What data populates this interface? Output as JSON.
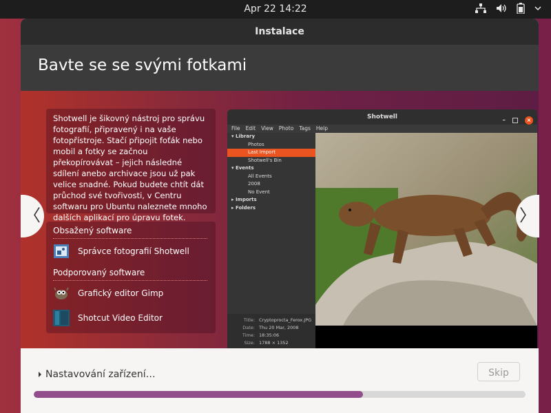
{
  "topbar": {
    "clock": "Apr 22  14:22",
    "icons": [
      "network-icon",
      "volume-icon",
      "battery-icon",
      "power-menu-icon"
    ]
  },
  "window": {
    "title": "Instalace"
  },
  "slide": {
    "title": "Bavte se se svými fotkami",
    "description": "Shotwell je šikovný nástroj pro správu fotografií, připravený i na vaše fotopřístroje. Stačí připojit foťák nebo mobil a fotky se začnou překopírovávat – jejich následné sdílení anebo archivace jsou už pak velice snadné. Pokud budete chtít dát průchod své tvořivosti, v Centru softwaru pro Ubuntu naleznete mnoho dalších aplikací pro úpravu fotek.",
    "included_heading": "Obsažený software",
    "included": [
      {
        "label": "Správce fotografií Shotwell",
        "icon": "shotwell-icon"
      }
    ],
    "supported_heading": "Podporovaný software",
    "supported": [
      {
        "label": "Grafický editor Gimp",
        "icon": "gimp-icon"
      },
      {
        "label": "Shotcut Video Editor",
        "icon": "shotcut-icon"
      }
    ],
    "prev_icon": "chevron-left-icon",
    "next_icon": "chevron-right-icon",
    "prev_glyph": "〈",
    "next_glyph": "〉"
  },
  "screenshot": {
    "title": "Shotwell",
    "minimize": "–",
    "close": "×",
    "menu": [
      "File",
      "Edit",
      "View",
      "Photo",
      "Tags",
      "Help"
    ],
    "sidebar": [
      {
        "label": "Library",
        "type": "header"
      },
      {
        "label": "Photos",
        "type": "sub"
      },
      {
        "label": "Last Import",
        "type": "sub-selected"
      },
      {
        "label": "Shotwell's Bin",
        "type": "sub"
      },
      {
        "label": "Events",
        "type": "header"
      },
      {
        "label": "All Events",
        "type": "sub"
      },
      {
        "label": "2008",
        "type": "sub"
      },
      {
        "label": "No Event",
        "type": "sub"
      },
      {
        "label": "Imports",
        "type": "header"
      },
      {
        "label": "Folders",
        "type": "header"
      }
    ],
    "meta": [
      {
        "k": "Title:",
        "v": "Cryptoprocta_Ferox.JPG"
      },
      {
        "k": "Date:",
        "v": "Thu 20 Mar, 2008"
      },
      {
        "k": "Time:",
        "v": "18:35:06"
      },
      {
        "k": "Size:",
        "v": "1788 × 1352"
      }
    ]
  },
  "footer": {
    "status": "Nastavování zařízení…",
    "skip_label": "Skip",
    "progress": 0.67
  },
  "colors": {
    "accent": "#e95420",
    "progress": "#924d8b",
    "topbar": "#1d1d1d"
  }
}
